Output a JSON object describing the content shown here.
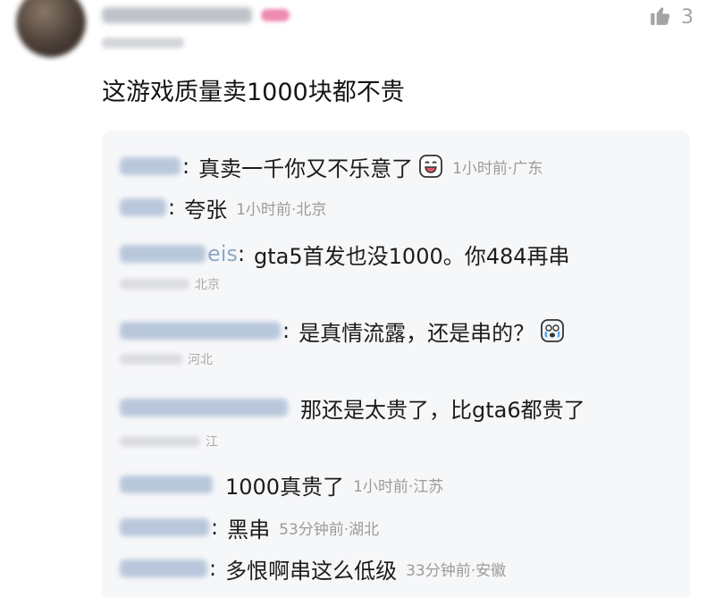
{
  "post": {
    "like_count": "3",
    "text": "这游戏质量卖1000块都不贵"
  },
  "replies": [
    {
      "colon": ":",
      "text": "真卖一千你又不乐意了",
      "time": "1小时前",
      "location": "广东",
      "emoji": "grinning-face-emoji"
    },
    {
      "colon": ":",
      "text": "夸张",
      "time": "1小时前",
      "location": "北京"
    },
    {
      "name_tail": "eis",
      "colon": ":",
      "text": "gta5首发也没1000。你484再串",
      "meta_partial": "北京"
    },
    {
      "colon": ":",
      "text": "是真情流露，还是串的？",
      "meta_partial": "河北",
      "emoji": "tearful-face-emoji"
    },
    {
      "text": "那还是太贵了，比gta6都贵了",
      "meta_partial": "江"
    },
    {
      "text": "1000真贵了",
      "time": "1小时前",
      "location": "江苏"
    },
    {
      "colon": ":",
      "text": "黑串",
      "time": "53分钟前",
      "location": "湖北"
    },
    {
      "colon": ":",
      "text": "多恨啊串这么低级",
      "time": "33分钟前",
      "location": "安徽"
    }
  ],
  "icons": {
    "like": "thumbs-up-icon"
  },
  "colors": {
    "meta_text": "#9b9b9b",
    "reply_bg": "#f6f7f9"
  }
}
